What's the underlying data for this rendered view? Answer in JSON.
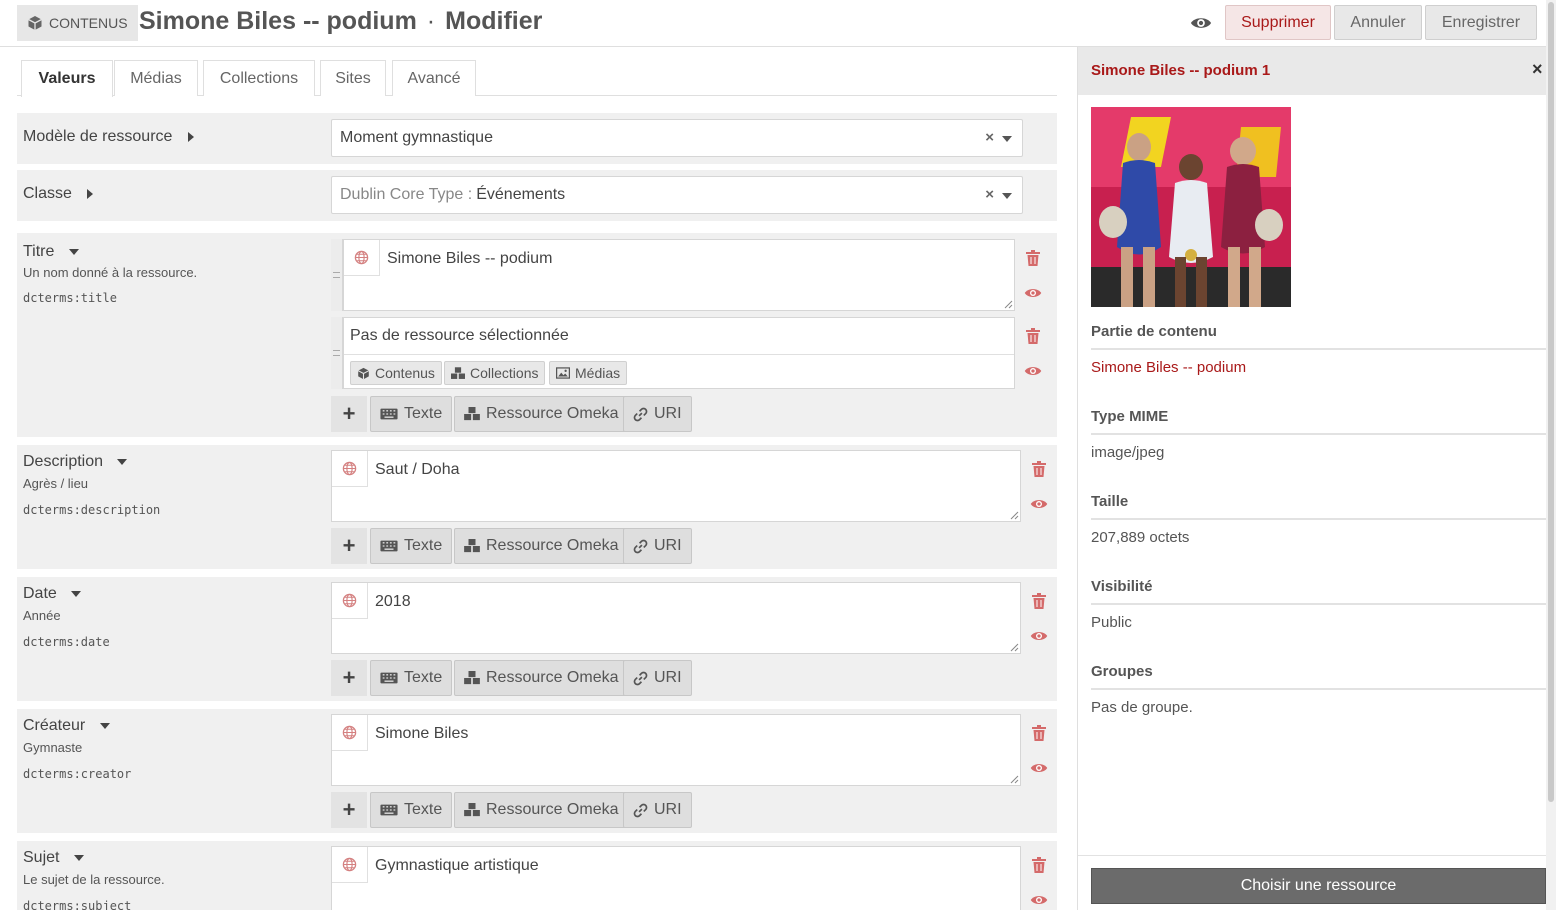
{
  "header": {
    "breadcrumb_label": "CONTENUS",
    "title": "Simone Biles -- podium",
    "title_sep": "·",
    "title_action": "Modifier",
    "buttons": {
      "delete": "Supprimer",
      "cancel": "Annuler",
      "save": "Enregistrer"
    }
  },
  "tabs": [
    "Valeurs",
    "Médias",
    "Collections",
    "Sites",
    "Avancé"
  ],
  "template": {
    "label": "Modèle de ressource",
    "value": "Moment gymnastique"
  },
  "class": {
    "label": "Classe",
    "vocab": "Dublin Core Type :",
    "value": "Événements"
  },
  "fields": {
    "title": {
      "label": "Titre",
      "help": "Un nom donné à la ressource.",
      "term": "dcterms:title",
      "value": "Simone Biles -- podium",
      "resource_placeholder": "Pas de ressource sélectionnée",
      "resource_buttons": [
        "Contenus",
        "Collections",
        "Médias"
      ]
    },
    "description": {
      "label": "Description",
      "help": "Agrès / lieu",
      "term": "dcterms:description",
      "value": "Saut / Doha"
    },
    "date": {
      "label": "Date",
      "help": "Année",
      "term": "dcterms:date",
      "value": "2018"
    },
    "creator": {
      "label": "Créateur",
      "help": "Gymnaste",
      "term": "dcterms:creator",
      "value": "Simone Biles"
    },
    "subject": {
      "label": "Sujet",
      "help": "Le sujet de la ressource.",
      "term": "dcterms:subject",
      "value": "Gymnastique artistique"
    }
  },
  "add_buttons": {
    "plus": "+",
    "text": "Texte",
    "resource": "Ressource Omeka",
    "uri": "URI"
  },
  "sidebar": {
    "title": "Simone Biles -- podium 1",
    "close": "×",
    "sections": [
      {
        "heading": "Partie de contenu",
        "value": "Simone Biles -- podium"
      },
      {
        "heading": "Type MIME",
        "value": "image/jpeg"
      },
      {
        "heading": "Taille",
        "value": "207,889 octets"
      },
      {
        "heading": "Visibilité",
        "value": "Public"
      },
      {
        "heading": "Groupes",
        "value": "Pas de groupe."
      }
    ],
    "choose_button": "Choisir une ressource"
  },
  "colors": {
    "accent": "#a91919",
    "panel": "#f0f0f0",
    "button": "#dedede",
    "primary_dark": "#6b6b6b"
  }
}
